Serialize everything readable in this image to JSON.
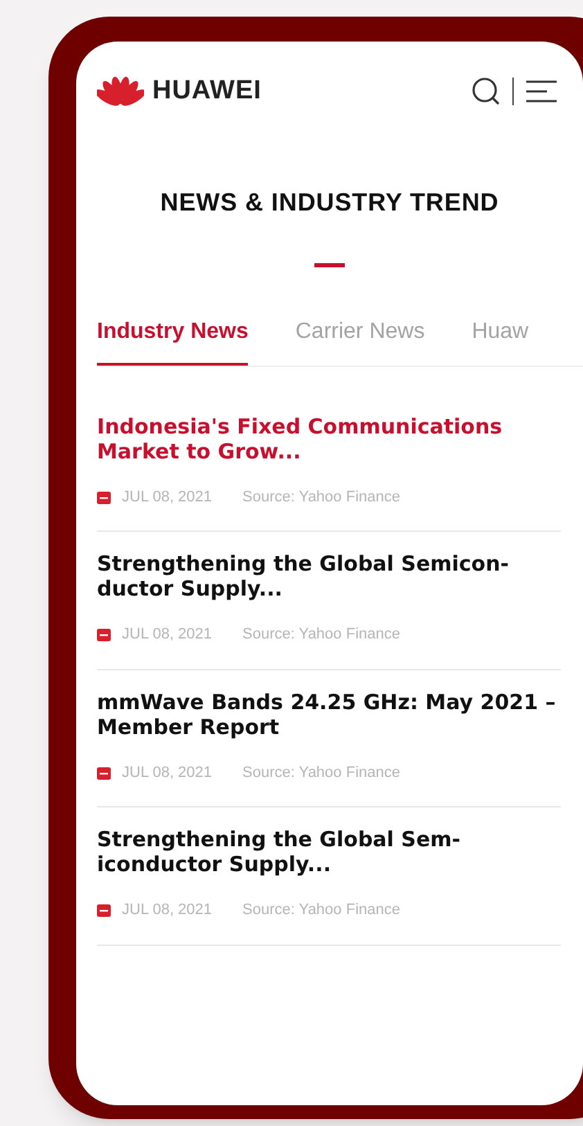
{
  "header": {
    "brand": "HUAWEI"
  },
  "section": {
    "title": "NEWS & INDUSTRY TREND"
  },
  "tabs": [
    {
      "label": "Industry News",
      "selected": true
    },
    {
      "label": "Carrier News",
      "selected": false
    },
    {
      "label": "Huaw",
      "selected": false
    }
  ],
  "articles": [
    {
      "title": "Indonesia's Fixed Communications Market to Grow...",
      "highlighted": true,
      "date": "JUL 08, 2021",
      "source": "Source: Yahoo Finance"
    },
    {
      "title": "Strengthening the Global Semicon-ductor Supply...",
      "highlighted": false,
      "date": "JUL 08, 2021",
      "source": "Source: Yahoo Finance"
    },
    {
      "title": "mmWave Bands 24.25 GHz: May 2021 – Member Report",
      "highlighted": false,
      "date": "JUL 08, 2021",
      "source": "Source: Yahoo Finance"
    },
    {
      "title": "Strengthening the Global Sem-iconductor Supply...",
      "highlighted": false,
      "date": "JUL 08, 2021",
      "source": "Source: Yahoo Finance"
    }
  ]
}
